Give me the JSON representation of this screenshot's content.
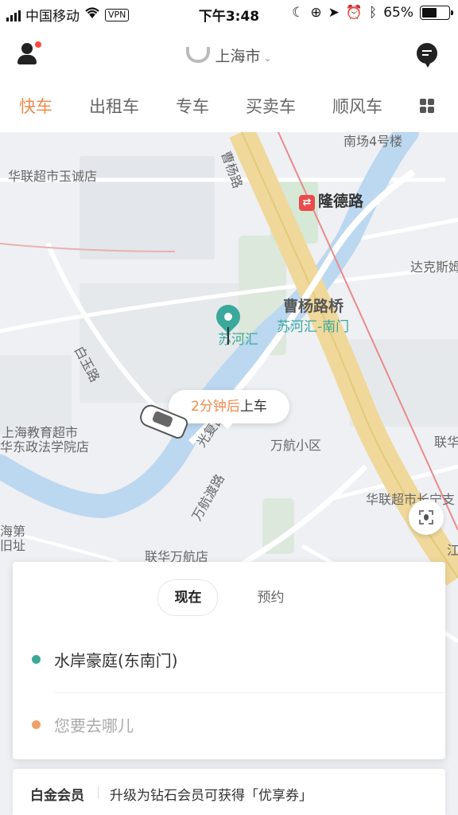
{
  "status_bar": {
    "carrier": "中国移动",
    "vpn": "VPN",
    "time": "下午3:48",
    "battery": "65%",
    "battery_level": 0.65
  },
  "header": {
    "city": "上海市",
    "icons": [
      "user-icon",
      "message-icon"
    ]
  },
  "tabs": [
    {
      "label": "快车",
      "active": true
    },
    {
      "label": "出租车",
      "active": false
    },
    {
      "label": "专车",
      "active": false
    },
    {
      "label": "买卖车",
      "active": false
    },
    {
      "label": "顺风车",
      "active": false
    }
  ],
  "map": {
    "labels": {
      "south_plaza": "南场4号楼",
      "supermarket_yucheng": "华联超市玉诚店",
      "caoyang_road": "曹杨路",
      "longde_metro": "隆德路",
      "dakesi": "达克斯姆",
      "caoyang_bridge": "曹杨路桥",
      "suhehui": "苏河汇",
      "suhehui_south": "苏河汇-南门",
      "baiyu_road": "白玉路",
      "guangfu_west_road": "光复西路",
      "edu_supermarket_1": "上海教育超市",
      "edu_supermarket_2": "华东政法学院店",
      "wanhang_community": "万航小区",
      "wanhangdu_road": "万航渡路",
      "lianhua_right": "联华",
      "lianhua_wanhang": "联华万航店",
      "hualian_changning": "华联超市长宁支",
      "shanghai_site_1": "海第",
      "shanghai_site_2": "旧址",
      "jiang_label": "江"
    },
    "pickup_bubble": {
      "time": "2分钟后",
      "action": "上车"
    },
    "metro_icon": "metro-icon",
    "colors": {
      "river": "#bcd7f0",
      "main_road": "#efd89a",
      "accent": "#f08a4b",
      "pin": "#3aa89a"
    }
  },
  "booking_panel": {
    "mode_tabs": [
      {
        "label": "现在",
        "active": true
      },
      {
        "label": "预约",
        "active": false
      }
    ],
    "from": "水岸豪庭(东南门)",
    "to_placeholder": "您要去哪儿"
  },
  "member_bar": {
    "title": "白金会员",
    "text": "升级为钻石会员可获得「优享券」"
  }
}
